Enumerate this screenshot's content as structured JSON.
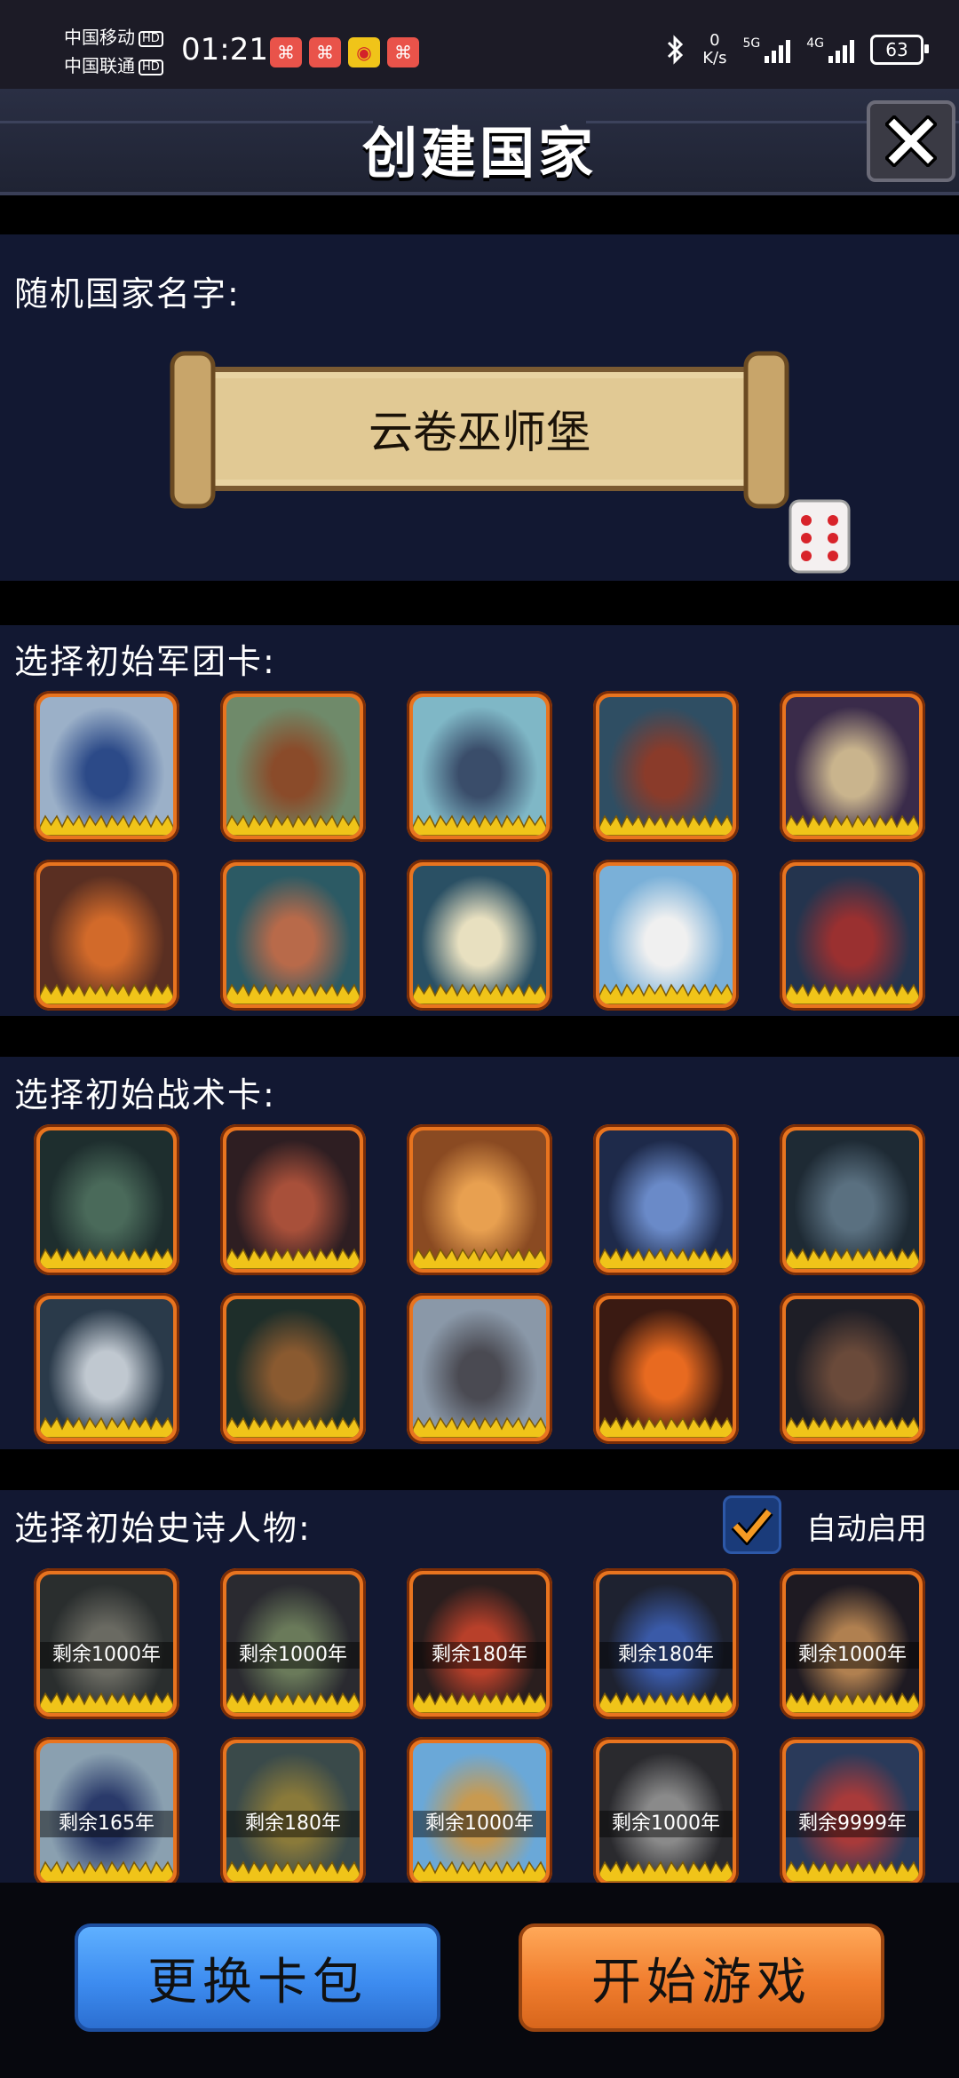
{
  "status_bar": {
    "carrier1": "中国移动",
    "carrier2": "中国联通",
    "hd": "HD",
    "time": "01:21",
    "net_speed_value": "0",
    "net_speed_unit": "K/s",
    "signal1_label": "5G",
    "signal2_label": "4G",
    "battery": "63"
  },
  "header": {
    "title": "创建国家"
  },
  "country": {
    "label": "随机国家名字:",
    "name": "云卷巫师堡"
  },
  "legion": {
    "label": "选择初始军团卡:",
    "cards": [
      {
        "name": "knight-cavalry-card",
        "bg": "#9bb0c8",
        "fg": "#2c4a88"
      },
      {
        "name": "spearman-rider-card",
        "bg": "#6f8a6a",
        "fg": "#8a4b2a"
      },
      {
        "name": "winged-warrior-card",
        "bg": "#7fb7c6",
        "fg": "#3a4d6a"
      },
      {
        "name": "dragon-card",
        "bg": "#2f4e63",
        "fg": "#8a3b2a"
      },
      {
        "name": "warship-card",
        "bg": "#3a2b4a",
        "fg": "#c9b48d"
      },
      {
        "name": "tiger-card",
        "bg": "#5a2f22",
        "fg": "#d26a2a"
      },
      {
        "name": "barbarian-card",
        "bg": "#2c5a64",
        "fg": "#b86a4a"
      },
      {
        "name": "mage-portal-card",
        "bg": "#2a5064",
        "fg": "#e8e0c0"
      },
      {
        "name": "white-horse-rider-card",
        "bg": "#7ab0d8",
        "fg": "#f0f0f0"
      },
      {
        "name": "dragon-knight-card",
        "bg": "#24344e",
        "fg": "#9a3030"
      }
    ]
  },
  "tactics": {
    "label": "选择初始战术卡:",
    "cards": [
      {
        "name": "shadow-assassin-card",
        "bg": "#1e2e2e",
        "fg": "#4a6a5a"
      },
      {
        "name": "tribal-chief-card",
        "bg": "#2e1e22",
        "fg": "#a8503a"
      },
      {
        "name": "longship-card",
        "bg": "#8a4a22",
        "fg": "#e8a050"
      },
      {
        "name": "cathedral-figure-card",
        "bg": "#1e2a4a",
        "fg": "#6a8ac8"
      },
      {
        "name": "dark-giant-card",
        "bg": "#1e2a34",
        "fg": "#5a7080"
      },
      {
        "name": "armored-knight-card",
        "bg": "#2a3a4a",
        "fg": "#c0c8d0"
      },
      {
        "name": "siege-engine-card",
        "bg": "#1e2e2a",
        "fg": "#8a5a30"
      },
      {
        "name": "snow-warriors-card",
        "bg": "#8a98a8",
        "fg": "#4a4a52"
      },
      {
        "name": "burning-castle-card",
        "bg": "#3a1a12",
        "fg": "#e86a20"
      },
      {
        "name": "dark-hall-card",
        "bg": "#1e1e26",
        "fg": "#6a4a3a"
      }
    ]
  },
  "heroes": {
    "label": "选择初始史诗人物:",
    "auto_enable_label": "自动启用",
    "auto_enable_checked": true,
    "cards": [
      {
        "name": "hero-ghost-card",
        "remain": "剩余1000年",
        "bg": "#2a2e2e",
        "fg": "#6a6a62"
      },
      {
        "name": "hero-general-card",
        "remain": "剩余1000年",
        "bg": "#2a2a30",
        "fg": "#6a7a5a"
      },
      {
        "name": "hero-king-card",
        "remain": "剩余180年",
        "bg": "#2a1e1e",
        "fg": "#b8402a"
      },
      {
        "name": "hero-warlord-card",
        "remain": "剩余180年",
        "bg": "#1e2230",
        "fg": "#3a5aa8"
      },
      {
        "name": "hero-sorceress-card",
        "remain": "剩余1000年",
        "bg": "#1e1a22",
        "fg": "#b08050"
      },
      {
        "name": "hero-emperor-card",
        "remain": "剩余165年",
        "bg": "#8aa0b0",
        "fg": "#2a3a6a"
      },
      {
        "name": "hero-bearded-lord-card",
        "remain": "剩余180年",
        "bg": "#3a4a4a",
        "fg": "#8a7a3a"
      },
      {
        "name": "hero-horseman-card",
        "remain": "剩余1000年",
        "bg": "#6aa8d8",
        "fg": "#c89a50"
      },
      {
        "name": "hero-shadow-figure-card",
        "remain": "剩余1000年",
        "bg": "#2a2a2e",
        "fg": "#8a8a8a"
      },
      {
        "name": "hero-swordsman-card",
        "remain": "剩余9999年",
        "bg": "#2a3a5a",
        "fg": "#a83a3a"
      }
    ]
  },
  "footer": {
    "change_pack": "更换卡包",
    "start_game": "开始游戏"
  },
  "colors": {
    "section_bg": "#121832",
    "card_border": "#e8741f",
    "crown": "#f0c419",
    "button_blue": "#3d8cf0",
    "button_orange": "#f07d2e"
  }
}
